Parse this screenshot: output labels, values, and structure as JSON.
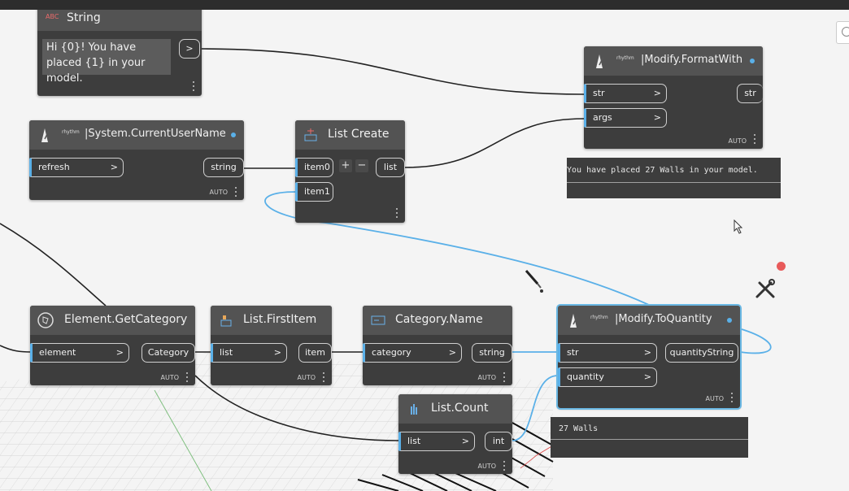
{
  "nodes": {
    "string": {
      "icon_text": "ABC",
      "title": "String",
      "value": "Hi {0}! You have placed {1} in your model.",
      "output_symbol": ">"
    },
    "format_with": {
      "brand": "rhythm",
      "title": "|Modify.FormatWith",
      "inputs": [
        "str",
        "args"
      ],
      "output": "str",
      "lacing": "AUTO",
      "preview": "You have placed 27 Walls in your model."
    },
    "current_user": {
      "brand": "rhythm",
      "title": "|System.CurrentUserName",
      "inputs": [
        "refresh"
      ],
      "output": "string",
      "lacing": "AUTO"
    },
    "list_create": {
      "title": "List Create",
      "inputs": [
        "item0",
        "item1"
      ],
      "add_label": "+",
      "remove_label": "−",
      "output": "list"
    },
    "get_category": {
      "title": "Element.GetCategory",
      "inputs": [
        "element"
      ],
      "output": "Category",
      "lacing": "AUTO"
    },
    "first_item": {
      "title": "List.FirstItem",
      "inputs": [
        "list"
      ],
      "output": "item",
      "lacing": "AUTO"
    },
    "category_name": {
      "title": "Category.Name",
      "inputs": [
        "category"
      ],
      "output": "string",
      "lacing": "AUTO"
    },
    "to_quantity": {
      "brand": "rhythm",
      "title": "|Modify.ToQuantity",
      "inputs": [
        "str",
        "quantity"
      ],
      "output": "quantityString",
      "lacing": "AUTO",
      "preview": "27 Walls"
    },
    "list_count": {
      "title": "List.Count",
      "inputs": [
        "list"
      ],
      "output": "int",
      "lacing": "AUTO"
    }
  },
  "colors": {
    "wire_active": "#5ab0e8",
    "wire": "#222222",
    "node_body": "#3d3d3d",
    "node_header": "#535353",
    "notify": "#e85a5a"
  }
}
